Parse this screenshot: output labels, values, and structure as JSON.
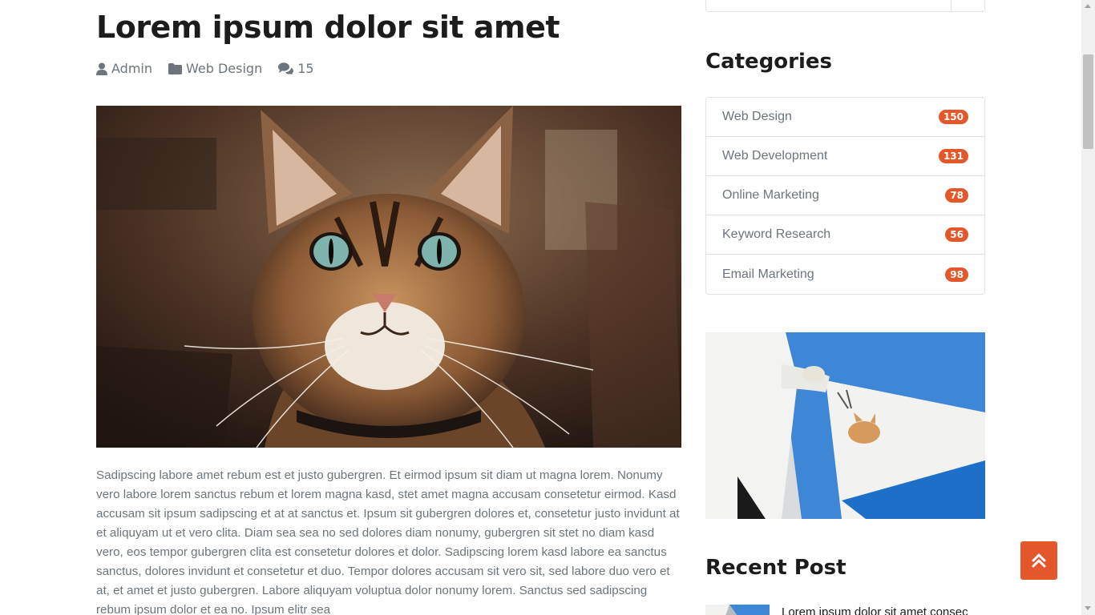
{
  "post": {
    "title": "Lorem ipsum dolor sit amet",
    "author": "Admin",
    "category": "Web Design",
    "comments": "15",
    "body": "Sadipscing labore amet rebum est et justo gubergren. Et eirmod ipsum sit diam ut magna lorem. Nonumy vero labore lorem sanctus rebum et lorem magna kasd, stet amet magna accusam consetetur eirmod. Kasd accusam sit ipsum sadipscing et at at sanctus et. Ipsum sit gubergren dolores et, consetetur justo invidunt at et aliquyam ut et vero clita. Diam sea sea no sed dolores diam nonumy, gubergren sit stet no diam kasd vero, eos tempor gubergren clita est consetetur dolores et dolor. Sadipscing lorem kasd labore ea sanctus sanctus, dolores invidunt et consetetur et duo. Tempor dolores accusam sit vero sit, sed labore duo vero et at, et amet et justo gubergren. Labore aliquyam voluptua dolor nonumy lorem. Sanctus sed sadipscing rebum ipsum dolor et ea no. Ipsum elitr sea"
  },
  "sidebar": {
    "categories_title": "Categories",
    "categories": [
      {
        "label": "Web Design",
        "count": "150"
      },
      {
        "label": "Web Development",
        "count": "131"
      },
      {
        "label": "Online Marketing",
        "count": "78"
      },
      {
        "label": "Keyword Research",
        "count": "56"
      },
      {
        "label": "Email Marketing",
        "count": "98"
      }
    ],
    "recent_title": "Recent Post",
    "recent_posts": [
      {
        "title": "Lorem ipsum dolor sit amet consec"
      }
    ]
  },
  "colors": {
    "accent": "#e3572a",
    "heading": "#1c1c1c",
    "text": "#6c757d"
  },
  "icons": {
    "author": "user-icon",
    "category": "folder-icon",
    "comments": "comments-icon",
    "back_to_top": "double-chevron-up-icon"
  }
}
